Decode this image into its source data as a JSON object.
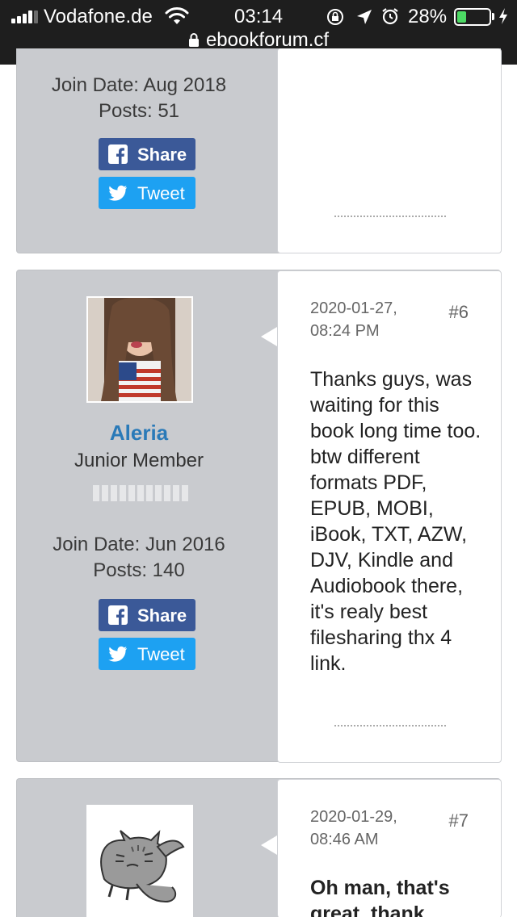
{
  "status_bar": {
    "carrier": "Vodafone.de",
    "time": "03:14",
    "battery_percent": "28%",
    "battery_level": 0.28,
    "battery_color": "#4cd964"
  },
  "url_bar": {
    "domain": "ebookforum.cf",
    "icon": "lock-icon"
  },
  "colors": {
    "share": "#3b5998",
    "tweet": "#1da1f2",
    "username": "#2a7ab8",
    "panel": "#c9cbcf"
  },
  "posts": [
    {
      "join_date": "Join Date: Aug 2018",
      "posts_count": "Posts: 51",
      "share_label": "Share",
      "tweet_label": "Tweet"
    },
    {
      "date_line1": "2020-01-27,",
      "date_line2": "08:24 PM",
      "number": "#6",
      "username": "Aleria",
      "user_title": "Junior Member",
      "join_date": "Join Date: Jun 2016",
      "posts_count": "Posts: 140",
      "share_label": "Share",
      "tweet_label": "Tweet",
      "body": "Thanks guys, was waiting for this book long time too. btw different formats PDF, EPUB, MOBI, iBook, TXT, AZW, DJV, Kindle and Audiobook there, it's realy best filesharing thx 4 link."
    },
    {
      "date_line1": "2020-01-29,",
      "date_line2": "08:46 AM",
      "number": "#7",
      "body": "Oh man, that's great, thank"
    }
  ]
}
